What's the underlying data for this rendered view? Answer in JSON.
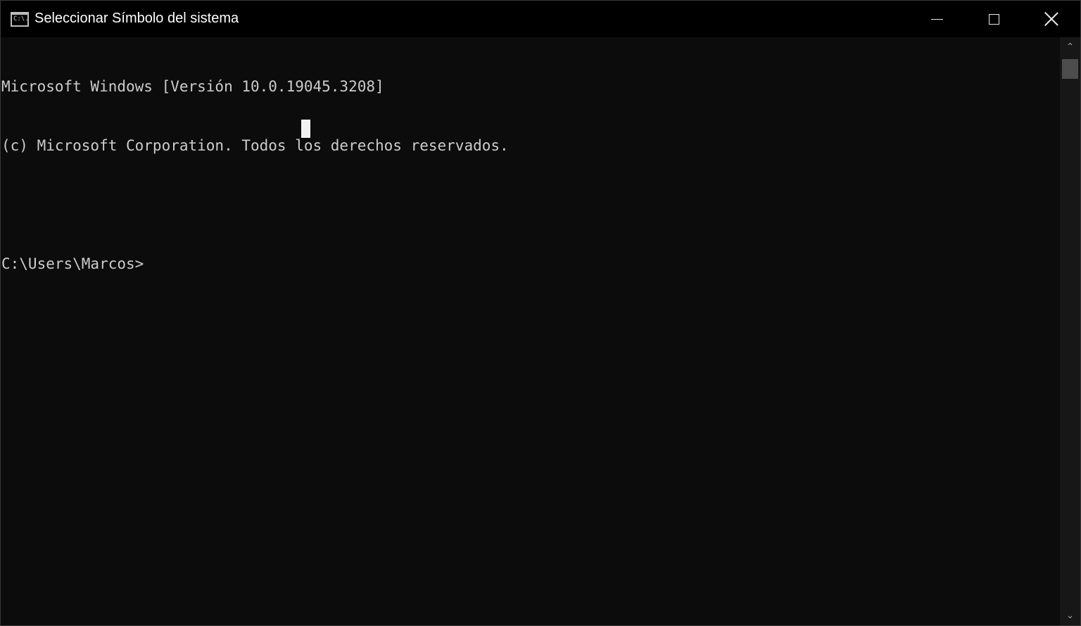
{
  "window": {
    "title": "Seleccionar Símbolo del sistema",
    "icon": "cmd-icon",
    "icon_text": "C:\\.",
    "controls": {
      "minimize": "minimize-icon",
      "maximize": "maximize-icon",
      "close": "close-icon"
    }
  },
  "console": {
    "lines": [
      "Microsoft Windows [Versión 10.0.19045.3208]",
      "(c) Microsoft Corporation. Todos los derechos reservados.",
      "",
      "C:\\Users\\Marcos>"
    ],
    "colors": {
      "background": "#0c0c0c",
      "text": "#cccccc"
    }
  },
  "scrollbar": {
    "up_icon": "chevron-up-icon",
    "down_icon": "chevron-down-icon"
  }
}
